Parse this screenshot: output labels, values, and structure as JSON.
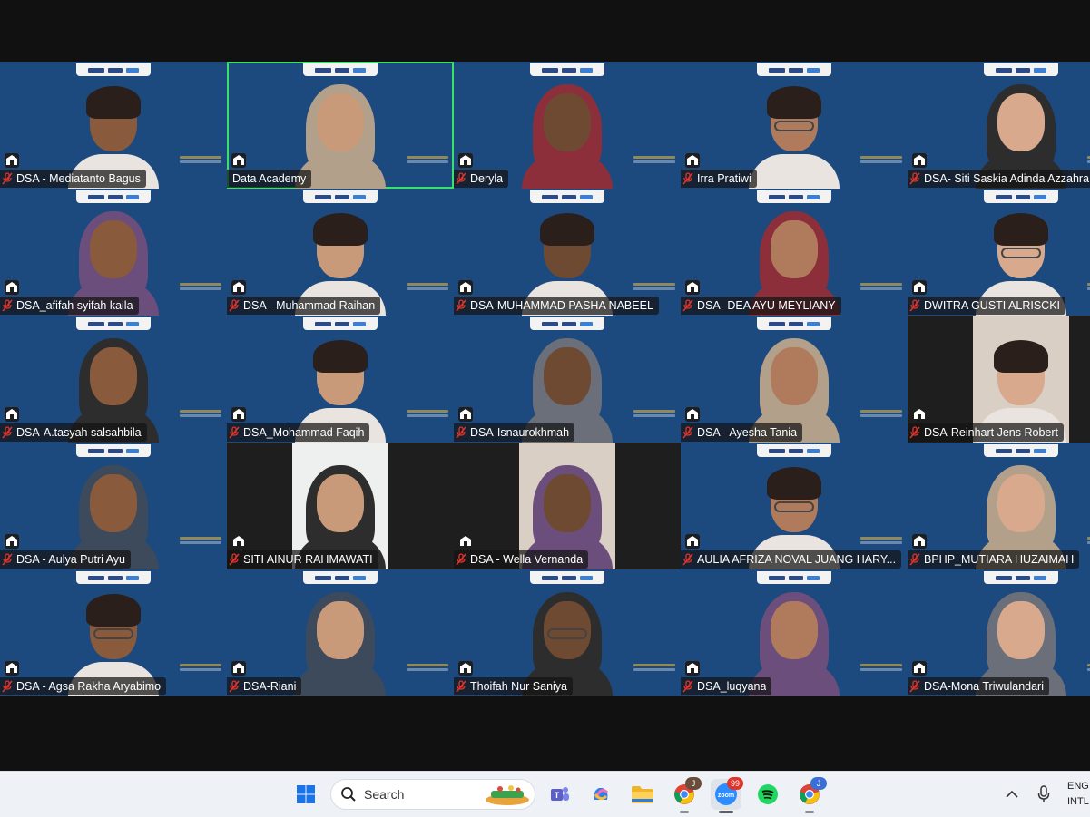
{
  "participants": [
    {
      "name": "DSA - Mediatanto Bagus",
      "active": false,
      "muted": true
    },
    {
      "name": "Data Academy",
      "active": true,
      "muted": false
    },
    {
      "name": "Deryla",
      "active": false,
      "muted": true
    },
    {
      "name": "Irra Pratiwi",
      "active": false,
      "muted": true
    },
    {
      "name": "DSA- Siti Saskia Adinda Azzahra",
      "active": false,
      "muted": true
    },
    {
      "name": "DSA_afifah syifah kaila",
      "active": false,
      "muted": true
    },
    {
      "name": "DSA - Muhammad Raihan",
      "active": false,
      "muted": true
    },
    {
      "name": "DSA-MUHAMMAD PASHA NABEEL",
      "active": false,
      "muted": true
    },
    {
      "name": "DSA- DEA AYU MEYLIANY",
      "active": false,
      "muted": true
    },
    {
      "name": "DWITRA GUSTI ALRISCKI",
      "active": false,
      "muted": true
    },
    {
      "name": "DSA-A.tasyah salsahbila",
      "active": false,
      "muted": true
    },
    {
      "name": "DSA_Mohammad Faqih",
      "active": false,
      "muted": true
    },
    {
      "name": "DSA-Isnaurokhmah",
      "active": false,
      "muted": true
    },
    {
      "name": "DSA - Ayesha Tania",
      "active": false,
      "muted": true
    },
    {
      "name": "DSA-Reinhart Jens Robert",
      "active": false,
      "muted": true
    },
    {
      "name": "DSA - Aulya Putri Ayu",
      "active": false,
      "muted": true
    },
    {
      "name": "SITI AINUR RAHMAWATI",
      "active": false,
      "muted": true
    },
    {
      "name": "DSA - Wella Vernanda",
      "active": false,
      "muted": true
    },
    {
      "name": "AULIA AFRIZA NOVAL JUANG HARY...",
      "active": false,
      "muted": true
    },
    {
      "name": "BPHP_MUTIARA HUZAIMAH",
      "active": false,
      "muted": true
    },
    {
      "name": "DSA - Agsa Rakha Aryabimo",
      "active": false,
      "muted": true
    },
    {
      "name": "DSA-Riani",
      "active": false,
      "muted": true
    },
    {
      "name": "Thoifah Nur Saniya",
      "active": false,
      "muted": true
    },
    {
      "name": "DSA_luqyana",
      "active": false,
      "muted": true
    },
    {
      "name": "DSA-Mona Triwulandari",
      "active": false,
      "muted": true
    }
  ],
  "taskbar": {
    "search_label": "Search",
    "apps": [
      "windows-start",
      "search",
      "teams",
      "copilot",
      "file-explorer",
      "chrome",
      "zoom",
      "spotify",
      "chrome-2"
    ],
    "zoom_badge": "99",
    "chrome_badge": "J",
    "chrome2_badge": "J",
    "lang_line1": "ENG",
    "lang_line2": "INTL"
  },
  "colors": {
    "tile_bg": "#1d4a7e",
    "active_border": "#3be06a",
    "mic_off": "#e0352b"
  }
}
